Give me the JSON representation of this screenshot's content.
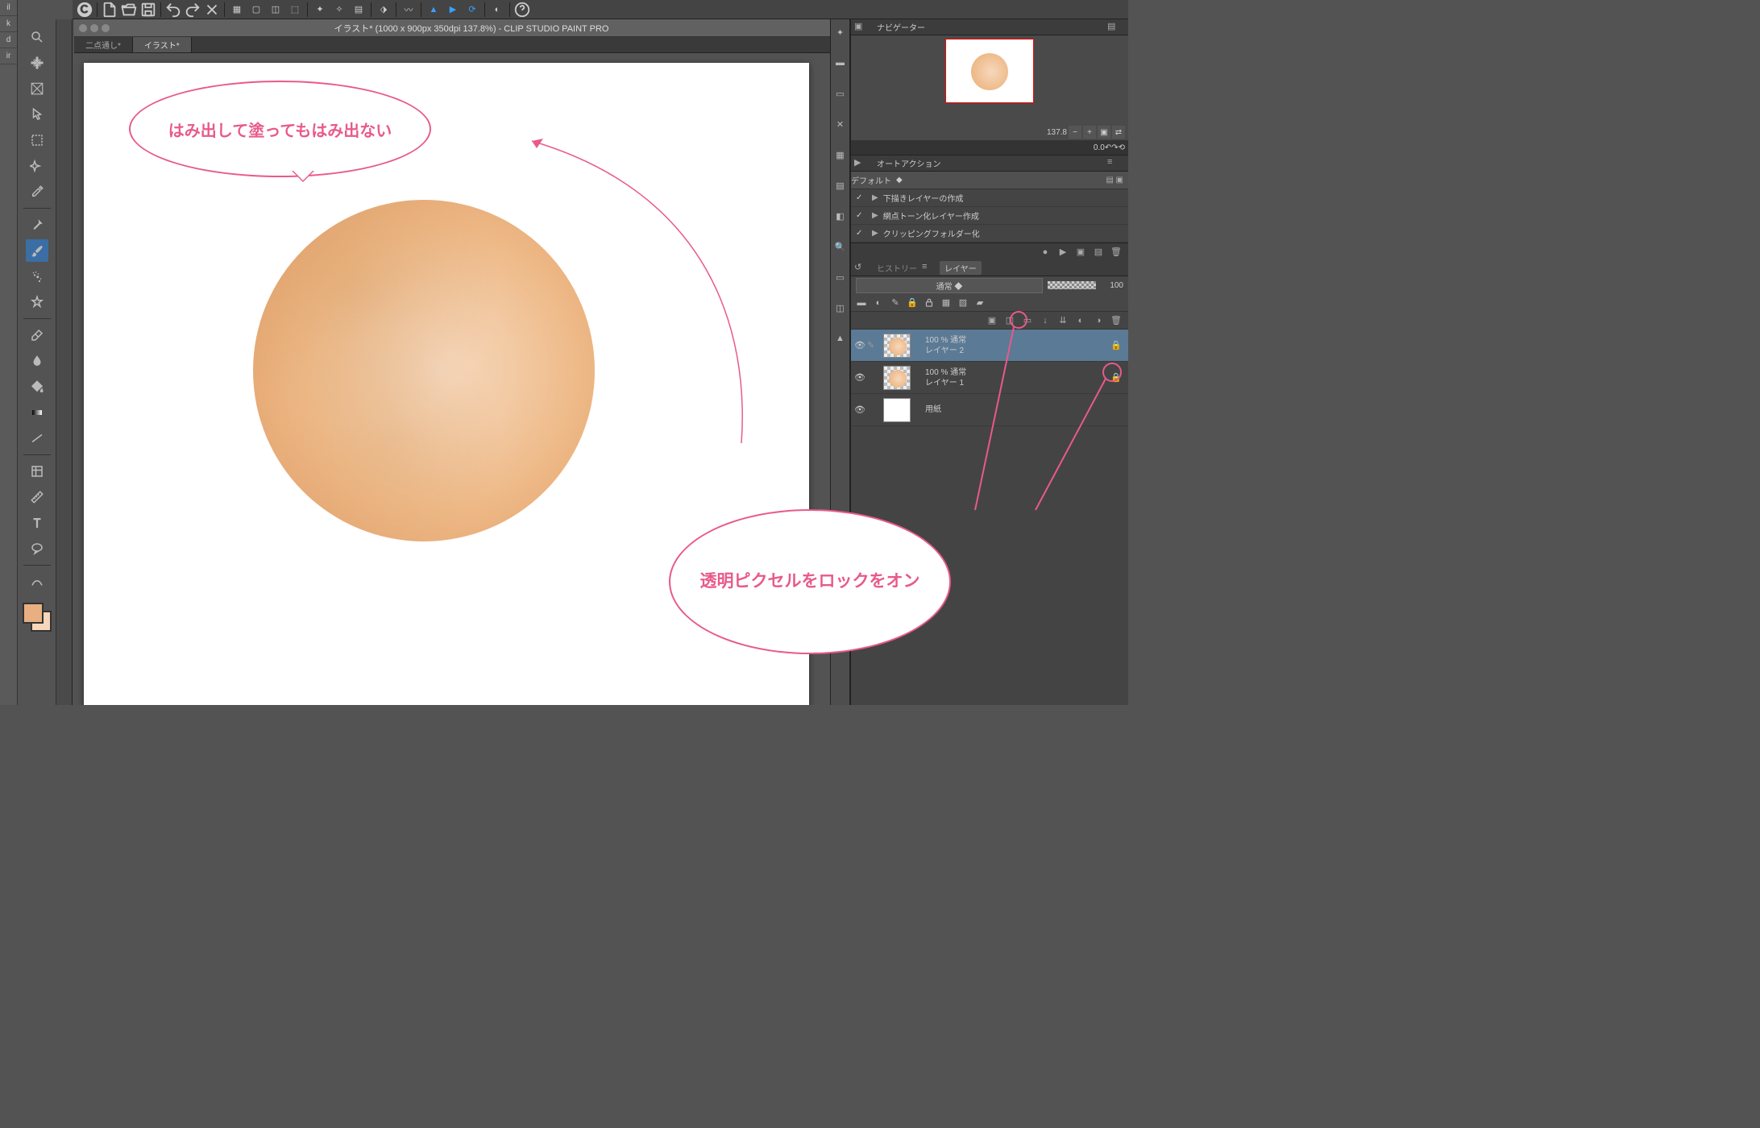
{
  "windowTitle": "イラスト* (1000 x 900px 350dpi 137.8%)  - CLIP STUDIO PAINT PRO",
  "tabs": [
    {
      "label": "二点通し*",
      "active": false
    },
    {
      "label": "イラスト*",
      "active": true
    }
  ],
  "navigator": {
    "tabLabel": "ナビゲーター",
    "zoom": "137.8",
    "rotation": "0.0"
  },
  "autoAction": {
    "tabLabel": "オートアクション",
    "setName": "デフォルト",
    "items": [
      "下描きレイヤーの作成",
      "網点トーン化レイヤー作成",
      "クリッピングフォルダー化"
    ]
  },
  "history": {
    "tabLabel": "ヒストリー"
  },
  "layerPanel": {
    "tabLabel": "レイヤー",
    "blendMode": "通常",
    "opacity": "100",
    "layers": [
      {
        "opacity": "100 %",
        "mode": "通常",
        "name": "レイヤー 2",
        "selected": true,
        "locked": true,
        "hasCircle": true
      },
      {
        "opacity": "100 %",
        "mode": "通常",
        "name": "レイヤー 1",
        "selected": false,
        "locked": true,
        "hasCircle": true
      },
      {
        "opacity": "",
        "mode": "",
        "name": "用紙",
        "selected": false,
        "locked": false,
        "hasCircle": false,
        "paper": true
      }
    ]
  },
  "annotations": {
    "bubble1": "はみ出して塗ってもはみ出ない",
    "bubble2": "透明ピクセルをロックをオン"
  },
  "colors": {
    "accent": "#e85a8a",
    "foreground": "#e8b082",
    "background": "#f7d6bb"
  }
}
